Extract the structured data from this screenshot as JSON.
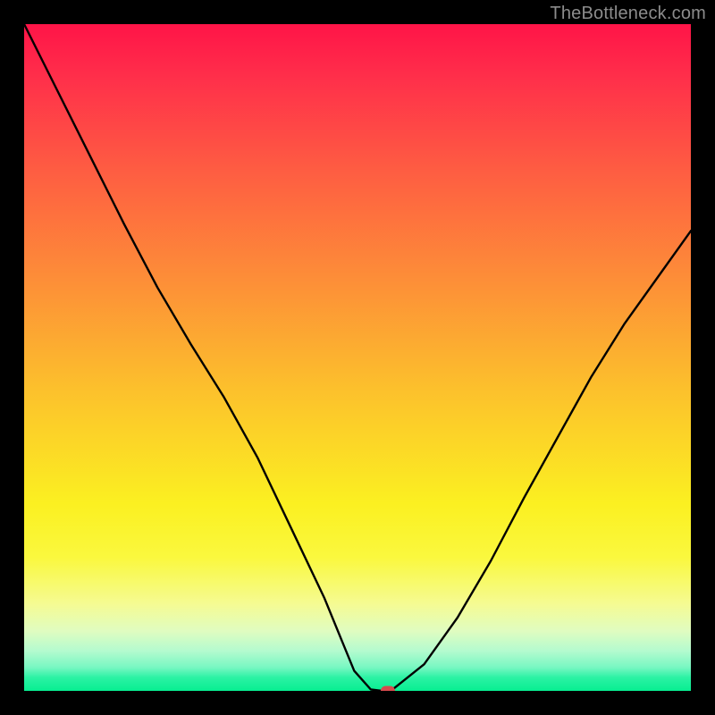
{
  "watermark": "TheBottleneck.com",
  "chart_data": {
    "type": "line",
    "title": "",
    "xlabel": "",
    "ylabel": "",
    "x": [
      0.0,
      0.05,
      0.1,
      0.15,
      0.2,
      0.25,
      0.3,
      0.35,
      0.4,
      0.45,
      0.495,
      0.52,
      0.54,
      0.55,
      0.6,
      0.65,
      0.7,
      0.75,
      0.8,
      0.85,
      0.9,
      0.95,
      1.0
    ],
    "y": [
      1.0,
      0.9,
      0.8,
      0.7,
      0.605,
      0.52,
      0.44,
      0.35,
      0.245,
      0.14,
      0.03,
      0.002,
      0.0,
      0.0,
      0.04,
      0.11,
      0.195,
      0.29,
      0.38,
      0.47,
      0.55,
      0.62,
      0.69
    ],
    "xlim": [
      0,
      1
    ],
    "ylim": [
      0,
      1
    ],
    "marker": {
      "x": 0.545,
      "y": 0.0
    },
    "background_gradient": {
      "stops": [
        {
          "pos": 0.0,
          "color": "#ff1448"
        },
        {
          "pos": 0.5,
          "color": "#fcb52f"
        },
        {
          "pos": 0.8,
          "color": "#faf83e"
        },
        {
          "pos": 1.0,
          "color": "#07ee91"
        }
      ]
    }
  }
}
